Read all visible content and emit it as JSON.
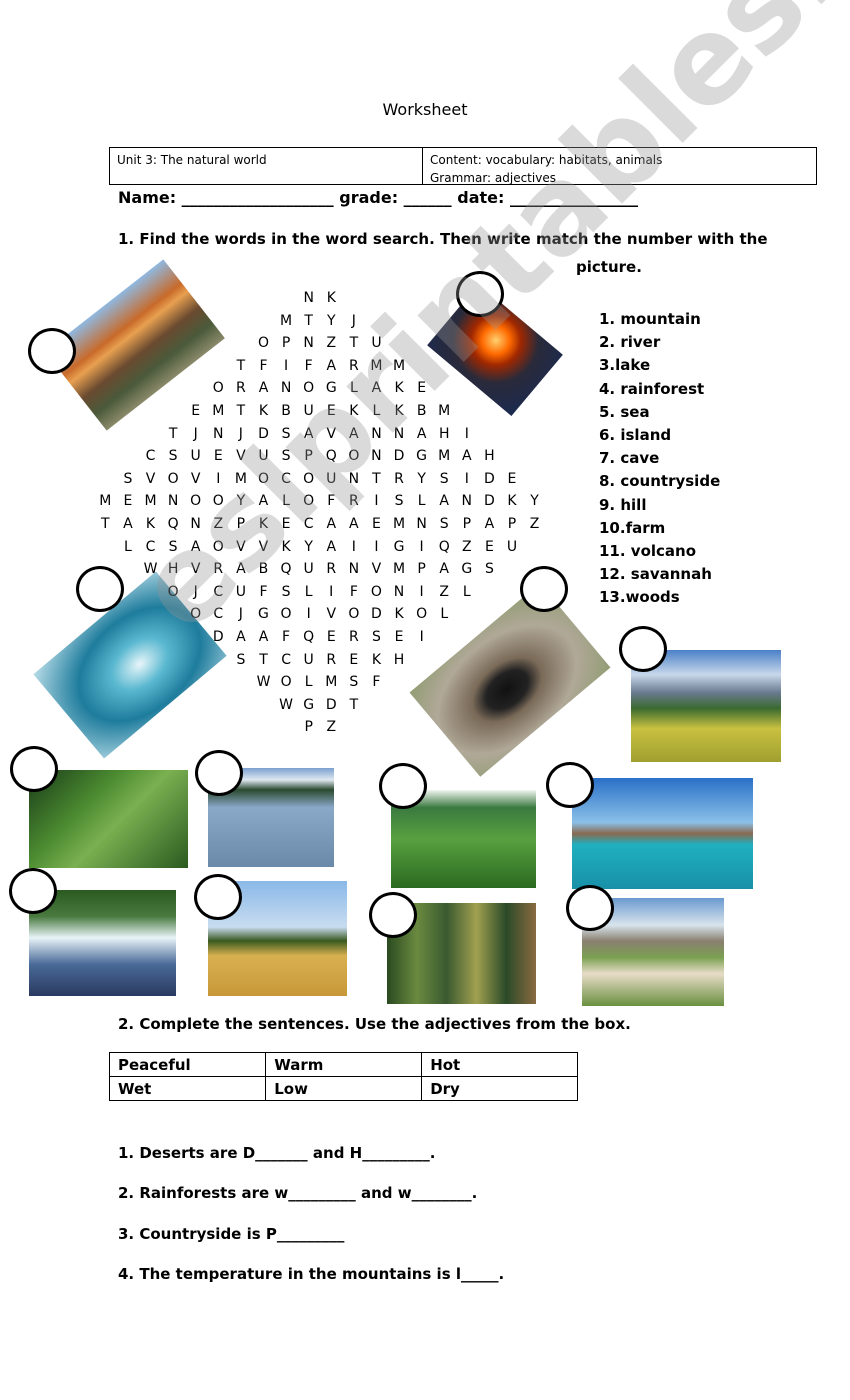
{
  "title": "Worksheet",
  "info": {
    "unit": "Unit 3: The natural world",
    "content": "Content: vocabulary: habitats, animals",
    "grammar": "Grammar: adjectives"
  },
  "name_line": "Name: ___________________ grade: ______ date: ________________",
  "task1": {
    "line1": "1. Find the words in the word search. Then write match the number with the",
    "line2": "picture."
  },
  "word_search": {
    "rows": [
      "NK",
      "MTYJ",
      "OPNZTU",
      "TFIFARMM",
      "ORANOGLAKE",
      "EMTKBUEKLKBM",
      "TJNJDSAVANNAHI",
      "CSUEVUSPQONDGMAH",
      "SVOVIMOCOUNTRYSIDE",
      "MEMNOOYALOFRISLANDKY",
      "TAKQNZPKECAAEMNSPAPZ",
      "LCSAOVVKYAIIGIQZEU",
      "WHVRABQURNVMPAGS",
      "OJCUFSLIFONIZL",
      "OCJGOIVODKOL",
      "DAAFQERSEI",
      "STCUREKH",
      "WOLMSF",
      "WGDT",
      "PZ"
    ]
  },
  "word_list": [
    "1. mountain",
    "2. river",
    "3.lake",
    "4. rainforest",
    "5. sea",
    "6. island",
    "7. cave",
    "8. countryside",
    "9. hill",
    "10.farm",
    "11. volcano",
    "12. savannah",
    "13.woods"
  ],
  "pictures": [
    {
      "subject": "mountain"
    },
    {
      "subject": "volcano"
    },
    {
      "subject": "sea wave"
    },
    {
      "subject": "cave"
    },
    {
      "subject": "countryside"
    },
    {
      "subject": "rainforest"
    },
    {
      "subject": "lake"
    },
    {
      "subject": "hill"
    },
    {
      "subject": "island"
    },
    {
      "subject": "river"
    },
    {
      "subject": "savannah"
    },
    {
      "subject": "woods"
    },
    {
      "subject": "farm"
    }
  ],
  "task2": {
    "heading": "2. Complete the sentences. Use the adjectives from the box.",
    "adjectives": [
      [
        "Peaceful",
        "Warm",
        "Hot"
      ],
      [
        "Wet",
        "Low",
        "Dry"
      ]
    ],
    "sentences": [
      "1. Deserts are D_______ and H_________.",
      "2. Rainforests are w_________ and w________.",
      "3. Countryside is P_________",
      "4. The temperature in the mountains is l_____."
    ]
  },
  "watermark": "eslprintables.com"
}
